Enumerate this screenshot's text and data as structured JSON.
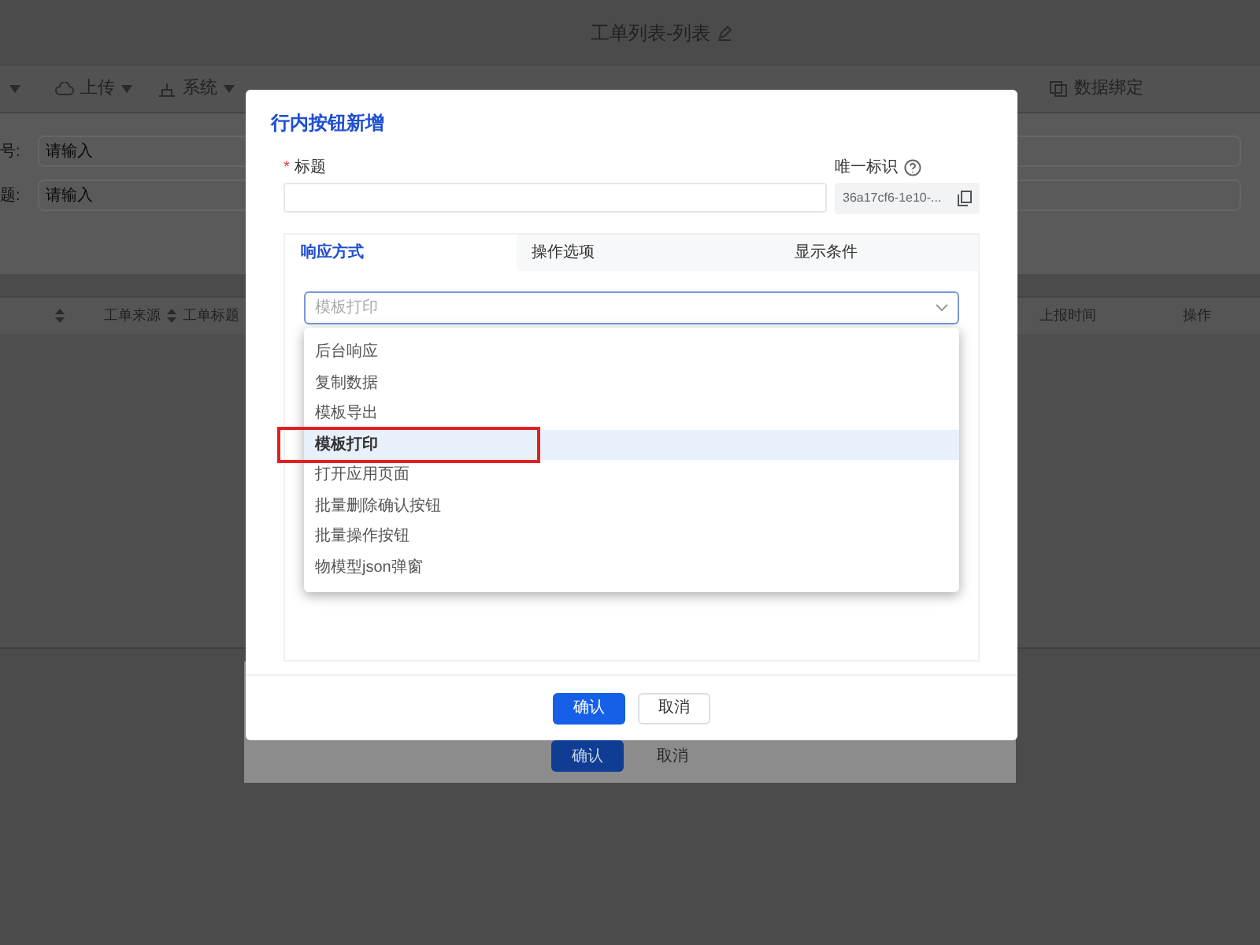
{
  "background_page": {
    "title": "工单列表-列表",
    "toolbar": [
      {
        "label": "上传",
        "has_menu": true
      },
      {
        "label": "系统",
        "has_menu": true
      },
      {
        "label": "数据绑定",
        "has_menu": false
      }
    ],
    "filters": [
      {
        "label": "号:",
        "placeholder": "请输入"
      },
      {
        "label": "题:",
        "placeholder": "请输入"
      }
    ],
    "table": {
      "columns": [
        "工单来源",
        "工单标题",
        "上报时间",
        "操作"
      ]
    },
    "back_dialog": {
      "buttons": [
        {
          "label": "确认",
          "kind": "primary"
        },
        {
          "label": "取消",
          "kind": "default"
        }
      ]
    }
  },
  "dialog": {
    "title": "行内按钮新增",
    "title_field": {
      "label": "标题",
      "required_mark": "*"
    },
    "id_field": {
      "label": "唯一标识",
      "value": "36a17cf6-1e10-..."
    },
    "tabs": [
      {
        "label": "响应方式",
        "selected": true
      },
      {
        "label": "操作选项",
        "selected": false
      },
      {
        "label": "显示条件",
        "selected": false
      }
    ],
    "select": {
      "value": "模板打印",
      "expanded": true
    },
    "options": [
      {
        "label": "后台响应",
        "selected": false
      },
      {
        "label": "复制数据",
        "selected": false
      },
      {
        "label": "模板导出",
        "selected": false
      },
      {
        "label": "模板打印",
        "selected": true
      },
      {
        "label": "打开应用页面",
        "selected": false
      },
      {
        "label": "批量删除确认按钮",
        "selected": false
      },
      {
        "label": "批量操作按钮",
        "selected": false
      },
      {
        "label": "物模型json弹窗",
        "selected": false
      }
    ],
    "buttons": [
      {
        "label": "确认",
        "kind": "primary"
      },
      {
        "label": "取消",
        "kind": "default"
      }
    ]
  },
  "annotation": {
    "kind": "highlight_box"
  }
}
